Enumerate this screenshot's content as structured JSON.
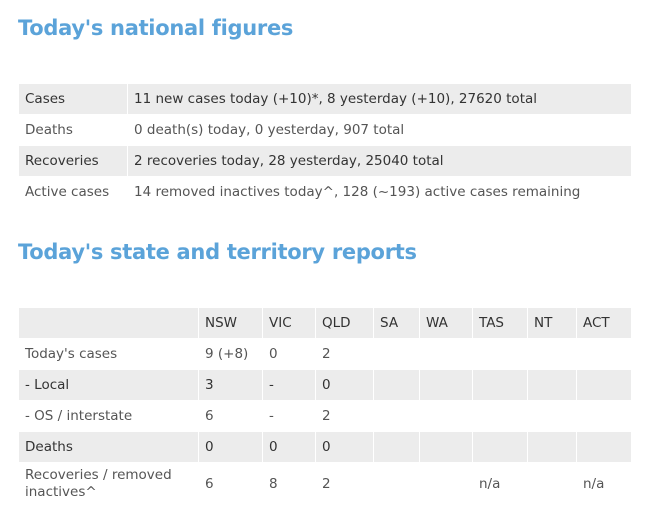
{
  "national": {
    "heading": "Today's national figures",
    "rows": [
      {
        "label": "Cases",
        "value": "11 new cases today (+10)*, 8 yesterday (+10), 27620 total"
      },
      {
        "label": "Deaths",
        "value": "0 death(s) today, 0 yesterday, 907 total"
      },
      {
        "label": "Recoveries",
        "value": "2 recoveries today, 28 yesterday, 25040 total"
      },
      {
        "label": "Active cases",
        "value": "14 removed inactives today^, 128 (~193) active cases remaining"
      }
    ]
  },
  "states": {
    "heading": "Today's state and territory reports",
    "columns": [
      "",
      "NSW",
      "VIC",
      "QLD",
      "SA",
      "WA",
      "TAS",
      "NT",
      "ACT"
    ],
    "rows": [
      [
        "Today's cases",
        "9 (+8)",
        "0",
        "2",
        "",
        "",
        "",
        "",
        ""
      ],
      [
        "- Local",
        "3",
        "-",
        "0",
        "",
        "",
        "",
        "",
        ""
      ],
      [
        "- OS / interstate",
        "6",
        "-",
        "2",
        "",
        "",
        "",
        "",
        ""
      ],
      [
        "Deaths",
        "0",
        "0",
        "0",
        "",
        "",
        "",
        "",
        ""
      ],
      [
        "Recoveries / removed inactives^",
        "6",
        "8",
        "2",
        "",
        "",
        "n/a",
        "",
        "n/a"
      ]
    ]
  }
}
